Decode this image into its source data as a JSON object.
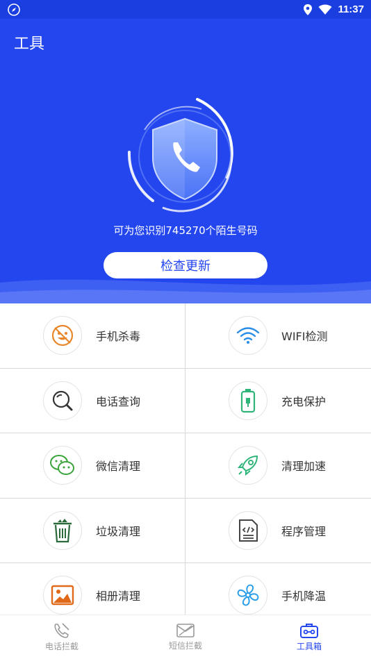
{
  "status_bar": {
    "time": "11:37"
  },
  "header": {
    "title": "工具"
  },
  "hero": {
    "recognize_text": "可为您识别745270个陌生号码",
    "update_button": "检查更新"
  },
  "tools": [
    {
      "label": "手机杀毒",
      "icon": "virus-icon",
      "color": "#e8872a"
    },
    {
      "label": "WIFI检测",
      "icon": "wifi-icon",
      "color": "#2a8ee8"
    },
    {
      "label": "电话查询",
      "icon": "search-icon",
      "color": "#333333"
    },
    {
      "label": "充电保护",
      "icon": "battery-icon",
      "color": "#2fb57a"
    },
    {
      "label": "微信清理",
      "icon": "wechat-icon",
      "color": "#3aa43a"
    },
    {
      "label": "清理加速",
      "icon": "rocket-icon",
      "color": "#2fb57a"
    },
    {
      "label": "垃圾清理",
      "icon": "trash-icon",
      "color": "#2a6a3a"
    },
    {
      "label": "程序管理",
      "icon": "code-file-icon",
      "color": "#444444"
    },
    {
      "label": "相册清理",
      "icon": "photo-icon",
      "color": "#e06a1a"
    },
    {
      "label": "手机降温",
      "icon": "fan-icon",
      "color": "#2a9ee8"
    }
  ],
  "bottom_nav": [
    {
      "label": "电话拦截",
      "icon": "phone-block-icon",
      "active": false
    },
    {
      "label": "短信拦截",
      "icon": "message-block-icon",
      "active": false
    },
    {
      "label": "工具箱",
      "icon": "toolbox-icon",
      "active": true
    }
  ]
}
